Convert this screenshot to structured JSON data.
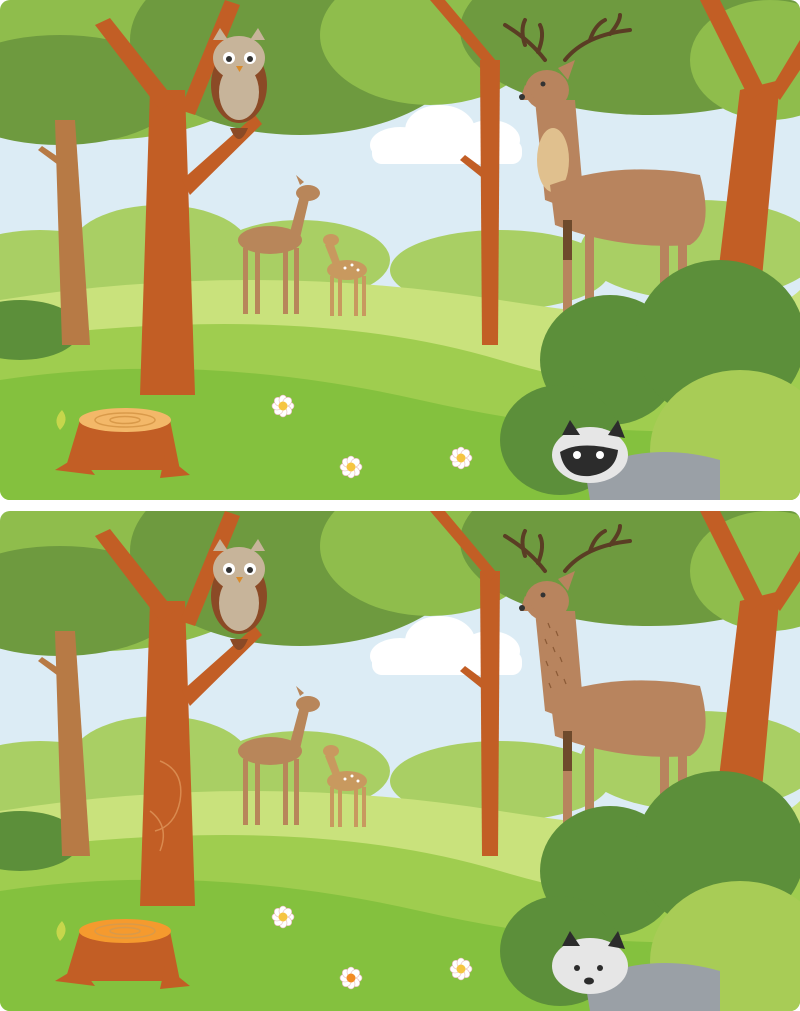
{
  "game": {
    "type": "spot-the-difference",
    "panels": [
      {
        "id": "original",
        "raccoon_face": "masked",
        "stump_top": "tan-rings",
        "flower_center": "yellow",
        "stag_chest": "light-patch",
        "tree_bark": "plain"
      },
      {
        "id": "modified",
        "raccoon_face": "plain-white",
        "stump_top": "orange-rings",
        "flower_center": "orange",
        "stag_chest": "spotted",
        "tree_bark": "swirled"
      }
    ],
    "scene_objects": [
      "owl",
      "deer",
      "fawn",
      "stag",
      "raccoon",
      "tree-stump",
      "daisy",
      "cloud",
      "bush",
      "tree"
    ]
  },
  "colors": {
    "sky": "#dcecf5",
    "cloud": "#ffffff",
    "canopy_dark": "#6e9a3f",
    "canopy_light": "#8fbd4c",
    "bush_far": "#a9cf64",
    "grass_light": "#c9e27c",
    "grass_mid": "#9fcd4f",
    "grass_front": "#84c13e",
    "bush_dark": "#5c8f3a",
    "bush_light": "#a8cc56",
    "trunk": "#c25e25",
    "trunk_far": "#b77a45",
    "owl_body": "#c7b49a",
    "owl_dark": "#8b4a26",
    "deer": "#b8865a",
    "stag": "#b8845e",
    "antler": "#5a3d24",
    "raccoon": "#9aa0a6",
    "raccoon_mask": "#2c2c2c",
    "stump": "#c25e25",
    "stump_top": "#f3b869",
    "stump_top_alt": "#f59a2e",
    "flower_center": "#f5c542",
    "flower_center_alt": "#f28b22"
  }
}
